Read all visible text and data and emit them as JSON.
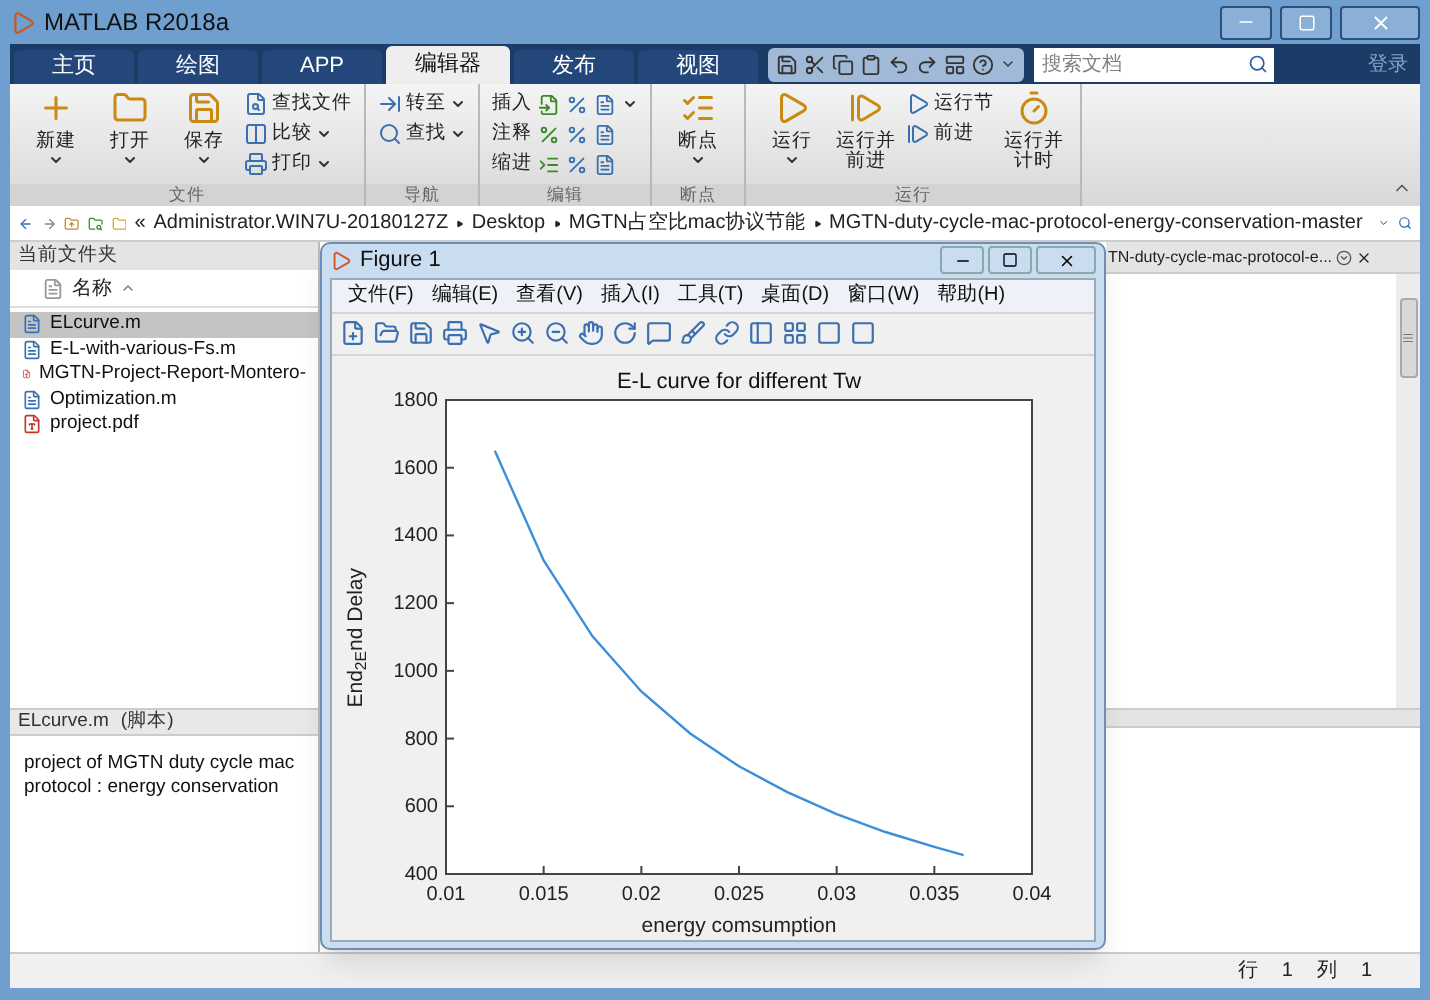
{
  "window": {
    "title": "MATLAB R2018a"
  },
  "tabs": [
    {
      "label": "主页",
      "selected": false
    },
    {
      "label": "绘图",
      "selected": false
    },
    {
      "label": "APP",
      "selected": false
    },
    {
      "label": "编辑器",
      "selected": true
    },
    {
      "label": "发布",
      "selected": false
    },
    {
      "label": "视图",
      "selected": false
    }
  ],
  "search": {
    "placeholder": "搜索文档"
  },
  "login": "登录",
  "ribbon": [
    {
      "label": "文件",
      "items": [
        {
          "label": "新建",
          "kind": "large",
          "menu": true
        },
        {
          "label": "打开",
          "kind": "large",
          "menu": true
        },
        {
          "label": "保存",
          "kind": "large",
          "menu": true
        },
        {
          "label": "查找文件",
          "kind": "small",
          "menu": false
        },
        {
          "label": "比较",
          "kind": "small",
          "menu": true
        },
        {
          "label": "打印",
          "kind": "small",
          "menu": true
        }
      ]
    },
    {
      "label": "导航",
      "items": [
        {
          "label": "转至",
          "kind": "small",
          "menu": true
        },
        {
          "label": "查找",
          "kind": "small",
          "menu": true
        }
      ]
    },
    {
      "label": "编辑",
      "items": [
        {
          "label": "插入",
          "kind": "row",
          "menu": true
        },
        {
          "label": "注释",
          "kind": "row",
          "menu": false
        },
        {
          "label": "缩进",
          "kind": "row",
          "menu": false
        }
      ]
    },
    {
      "label": "断点",
      "items": [
        {
          "label": "断点",
          "kind": "large",
          "menu": true
        }
      ]
    },
    {
      "label": "运行",
      "items": [
        {
          "label": "运行",
          "kind": "large",
          "menu": true
        },
        {
          "label": "运行并前进",
          "kind": "large",
          "menu": false
        },
        {
          "label": "运行节",
          "kind": "small",
          "menu": false
        },
        {
          "label": "前进",
          "kind": "small",
          "menu": false
        },
        {
          "label": "运行并计时",
          "kind": "large",
          "menu": false
        }
      ]
    }
  ],
  "address_prefix": "«",
  "address": [
    "Administrator.WIN7U-20180127Z",
    "Desktop",
    "MGTN占空比mac协议节能",
    "MGTN-duty-cycle-mac-protocol-energy-conservation-master"
  ],
  "current_folder": {
    "title": "当前文件夹",
    "column": "名称",
    "files": [
      {
        "name": "ELcurve.m",
        "kind": "script",
        "selected": true
      },
      {
        "name": "E-L-with-various-Fs.m",
        "kind": "script",
        "selected": false
      },
      {
        "name": "MGTN-Project-Report-Montero-",
        "kind": "pdf",
        "selected": false
      },
      {
        "name": "Optimization.m",
        "kind": "script",
        "selected": false
      },
      {
        "name": "project.pdf",
        "kind": "pdf",
        "selected": false
      }
    ]
  },
  "details": {
    "file": "ELcurve.m",
    "type": "(脚本)",
    "lines": [
      "project of MGTN duty cycle mac",
      "protocol : energy conservation"
    ]
  },
  "editor": {
    "tab": "TN-duty-cycle-mac-protocol-e..."
  },
  "status_bar": {
    "row_label": "行",
    "row": "1",
    "col_label": "列",
    "col": "1"
  },
  "figure": {
    "title": "Figure 1",
    "menu": [
      "文件(F)",
      "编辑(E)",
      "查看(V)",
      "插入(I)",
      "工具(T)",
      "桌面(D)",
      "窗口(W)",
      "帮助(H)"
    ],
    "chart_data": {
      "type": "line",
      "title": "E-L curve for different Tw",
      "xlabel": "energy comsumption",
      "ylabel": "End$_{2E}$nd Delay",
      "x": [
        0.0125,
        0.015,
        0.0175,
        0.02,
        0.0225,
        0.025,
        0.0275,
        0.03,
        0.0325,
        0.035,
        0.0365
      ],
      "series": [
        {
          "color": "#3b8fd9",
          "values": [
            1650,
            1326,
            1102,
            939,
            815,
            718,
            641,
            577,
            524,
            480,
            456
          ]
        }
      ],
      "xlim": [
        0.01,
        0.04
      ],
      "ylim": [
        400,
        1800
      ],
      "xticks": [
        0.01,
        0.015,
        0.02,
        0.025,
        0.03,
        0.035,
        0.04
      ],
      "yticks": [
        400,
        600,
        800,
        1000,
        1200,
        1400,
        1600,
        1800
      ]
    }
  }
}
